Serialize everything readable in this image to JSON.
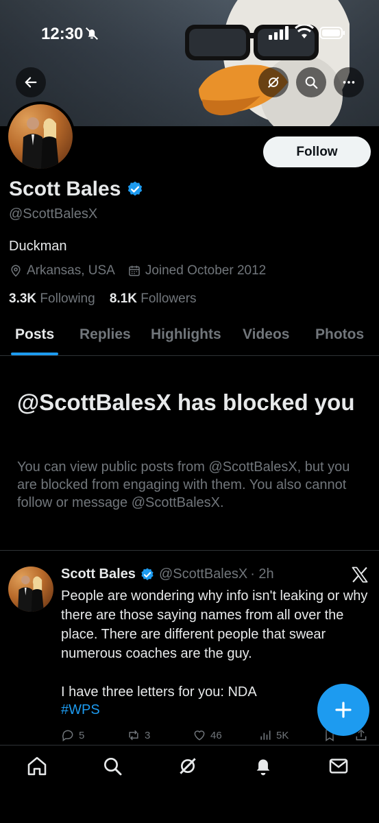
{
  "status_bar": {
    "time": "12:30"
  },
  "profile": {
    "name": "Scott Bales",
    "handle": "@ScottBalesX",
    "bio": "Duckman",
    "location": "Arkansas, USA",
    "joined": "Joined October 2012",
    "following_count": "3.3K",
    "following_label": "Following",
    "followers_count": "8.1K",
    "followers_label": "Followers",
    "follow_button": "Follow"
  },
  "tabs": [
    {
      "label": "Posts",
      "active": true
    },
    {
      "label": "Replies"
    },
    {
      "label": "Highlights"
    },
    {
      "label": "Videos"
    },
    {
      "label": "Photos"
    }
  ],
  "blocked": {
    "title": "@ScottBalesX has blocked you",
    "description": "You can view public posts from @ScottBalesX, but you are blocked from engaging with them. You also cannot follow or message @ScottBalesX."
  },
  "post": {
    "author": "Scott Bales",
    "handle": "@ScottBalesX",
    "time": "· 2h",
    "text": "People are wondering why info isn't leaking or why there are those saying names from all over the place.  There are different people that swear numerous coaches are the guy.\n\nI have three letters for you:  NDA",
    "hashtag": "#WPS",
    "replies": "5",
    "reposts": "3",
    "likes": "46",
    "views": "5K"
  },
  "colors": {
    "accent": "#1d9bf0",
    "background": "#000000",
    "muted": "#71767b",
    "text": "#e7e9ea"
  },
  "icons": {
    "banner": [
      "back-arrow-icon",
      "grok-icon",
      "search-icon",
      "more-icon"
    ],
    "nav": [
      "home-icon",
      "search-icon",
      "grok-icon",
      "notifications-icon",
      "messages-icon"
    ]
  }
}
